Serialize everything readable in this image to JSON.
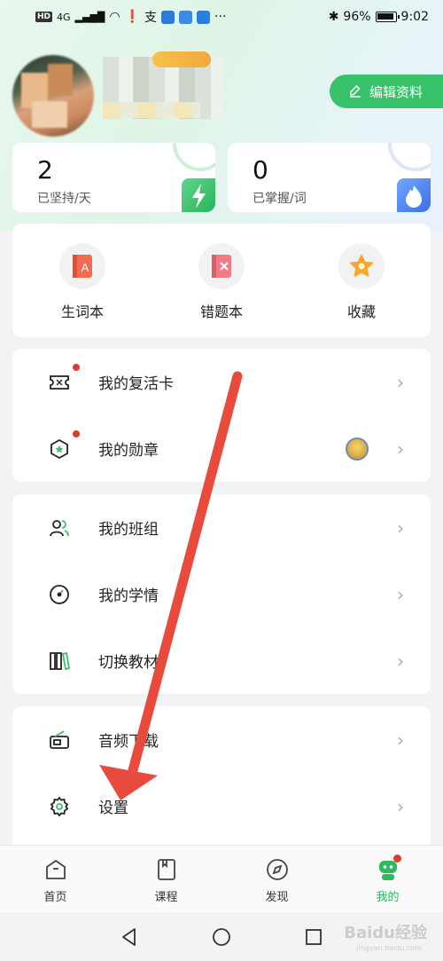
{
  "status_bar": {
    "hd": "HD",
    "network": "4G",
    "ime": "支",
    "battery_pct": "96%",
    "time": "9:02",
    "more": "···"
  },
  "profile": {
    "vip_badge": "",
    "edit_button": "编辑资料"
  },
  "stats": [
    {
      "value": "2",
      "label": "已坚持/天",
      "icon": "lightning-icon"
    },
    {
      "value": "0",
      "label": "已掌握/词",
      "icon": "flame-icon"
    }
  ],
  "shortcuts": [
    {
      "label": "生词本",
      "icon": "vocab-book-icon"
    },
    {
      "label": "错题本",
      "icon": "wrong-book-icon"
    },
    {
      "label": "收藏",
      "icon": "star-icon"
    }
  ],
  "groups": [
    [
      {
        "label": "我的复活卡",
        "icon": "ticket-icon",
        "dot": true,
        "chevron": "›"
      },
      {
        "label": "我的勋章",
        "icon": "badge-icon",
        "dot": true,
        "medal": true,
        "chevron": "›"
      }
    ],
    [
      {
        "label": "我的班组",
        "icon": "group-icon",
        "chevron": "›"
      },
      {
        "label": "我的学情",
        "icon": "gauge-icon",
        "chevron": "›"
      },
      {
        "label": "切换教材",
        "icon": "books-icon",
        "chevron": "›"
      }
    ],
    [
      {
        "label": "音频下载",
        "icon": "radio-icon",
        "chevron": "›"
      },
      {
        "label": "设置",
        "icon": "gear-icon",
        "chevron": "›"
      }
    ]
  ],
  "bottom_nav": [
    {
      "label": "首页",
      "icon": "home-icon"
    },
    {
      "label": "课程",
      "icon": "course-icon"
    },
    {
      "label": "发现",
      "icon": "compass-icon"
    },
    {
      "label": "我的",
      "icon": "profile-icon",
      "active": true
    }
  ],
  "watermark": {
    "text": "Baidu经验",
    "sub": "jingyan.baidu.com"
  },
  "colors": {
    "accent_green": "#38c26a",
    "active_tab": "#2fb85e",
    "red_dot": "#e23a30",
    "annotation_arrow": "#e84a3c"
  }
}
